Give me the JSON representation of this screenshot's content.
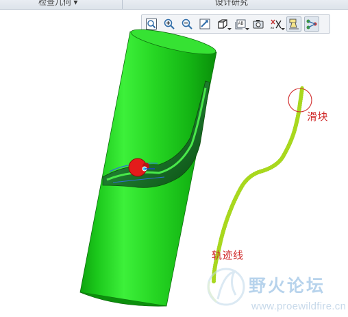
{
  "top_tabs": {
    "left": "检查几何 ▾",
    "right": "设计研究"
  },
  "toolbar": {
    "buttons": [
      {
        "name": "zoom-fit",
        "icon": "zoom-fit-icon"
      },
      {
        "name": "zoom-in",
        "icon": "zoom-in-icon"
      },
      {
        "name": "zoom-out",
        "icon": "zoom-out-icon"
      },
      {
        "name": "refit",
        "icon": "refit-icon"
      },
      {
        "name": "display-style",
        "icon": "cube-icon"
      },
      {
        "name": "saved-views",
        "icon": "saved-views-icon"
      },
      {
        "name": "view-manager",
        "icon": "view-manager-icon"
      },
      {
        "name": "datum-display",
        "icon": "datum-display-icon"
      },
      {
        "name": "annotation-display",
        "icon": "annotation-display-icon"
      },
      {
        "name": "spin-center",
        "icon": "spin-center-icon"
      }
    ]
  },
  "model": {
    "labels": {
      "slider": "滑块",
      "path": "轨迹线"
    }
  },
  "watermark": {
    "text": "野火论坛",
    "url": "www.proewildfire.cn"
  },
  "colors": {
    "cylinder": "#21cc1c",
    "cylinder_dark": "#0e9a0e",
    "path_line": "#9bd11a",
    "slider_red": "#e41b1b",
    "label_red": "#d02a2a"
  }
}
